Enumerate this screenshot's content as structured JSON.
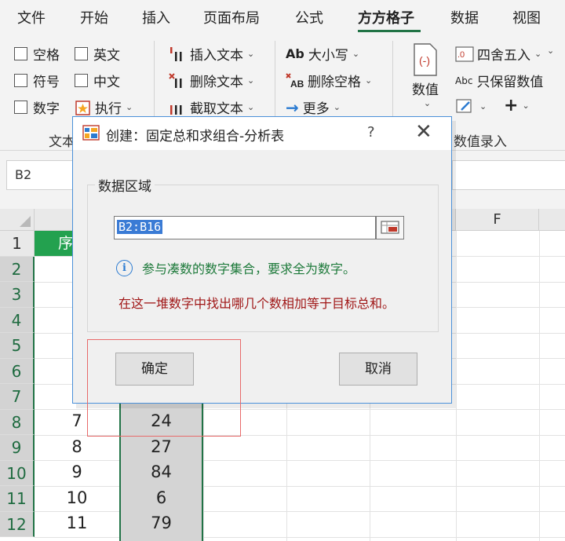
{
  "ribbon_tabs": [
    {
      "label": "文件"
    },
    {
      "label": "开始"
    },
    {
      "label": "插入"
    },
    {
      "label": "页面布局"
    },
    {
      "label": "公式"
    },
    {
      "label": "方方格子",
      "active": true
    },
    {
      "label": "数据"
    },
    {
      "label": "视图"
    }
  ],
  "ribbon": {
    "checkboxes": [
      "空格",
      "英文",
      "符号",
      "中文",
      "数字"
    ],
    "execute": "执行",
    "text_tools": [
      "插入文本",
      "删除文本",
      "截取文本"
    ],
    "case_tools": [
      "大小写",
      "删除空格",
      "更多"
    ],
    "number_button": "数值",
    "number_tools": [
      "四舍五入",
      "只保留数值"
    ],
    "text_group_label": "文本",
    "number_group_label": "数值录入",
    "icons": {
      "plus": "+",
      "ab": "Ab",
      "abc": "Abc"
    }
  },
  "namebox": "B2",
  "grid": {
    "col_header_F": "F",
    "row_headers": [
      "1",
      "2",
      "3",
      "4",
      "5",
      "6",
      "7",
      "8",
      "9",
      "10",
      "11",
      "12"
    ],
    "a1_text": "序",
    "rows": [
      {
        "a": "7",
        "b": "24"
      },
      {
        "a": "8",
        "b": "27"
      },
      {
        "a": "9",
        "b": "84"
      },
      {
        "a": "10",
        "b": "6"
      },
      {
        "a": "11",
        "b": "79"
      }
    ]
  },
  "dialog": {
    "title": "创建：固定总和求组合-分析表",
    "help": "?",
    "close": "✕",
    "section": "数据区域",
    "range_value": "B2:B16",
    "info": "参与凑数的数字集合，要求全为数字。",
    "description": "在这一堆数字中找出哪几个数相加等于目标总和。",
    "ok": "确定",
    "cancel": "取消"
  },
  "colors": {
    "excel_green": "#217346",
    "header_fill": "#23a14f",
    "info_green": "#1e7a3b",
    "desc_red": "#a01717",
    "annotation_red": "#e86a6a",
    "dialog_border": "#4a90d9"
  }
}
